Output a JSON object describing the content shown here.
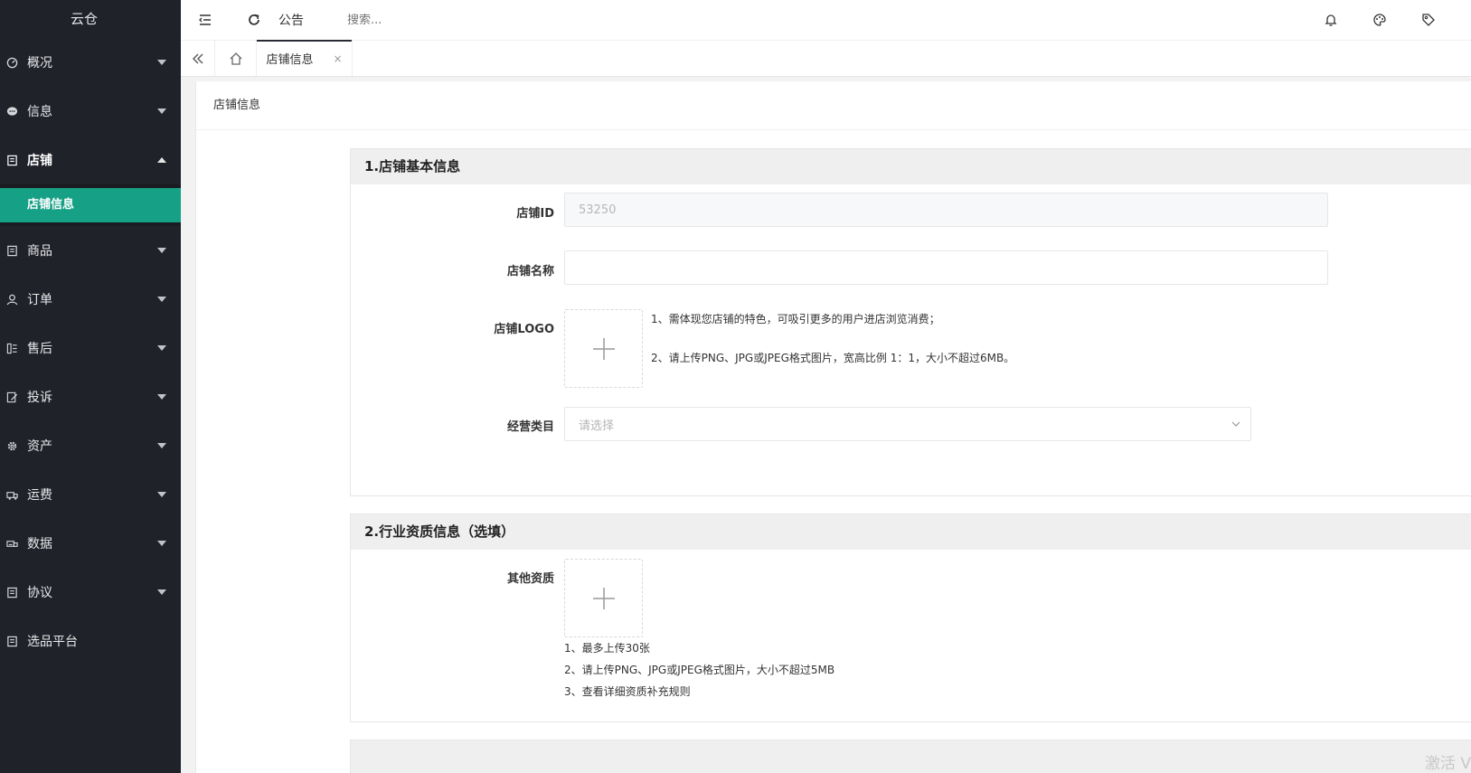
{
  "app": {
    "title": "云仓"
  },
  "sidebar": {
    "items": [
      {
        "label": "概况",
        "icon": "dashboard-icon"
      },
      {
        "label": "信息",
        "icon": "chat-bubble-icon"
      },
      {
        "label": "店铺",
        "icon": "document-icon",
        "open": true,
        "children": [
          {
            "label": "店铺信息",
            "active": true
          }
        ]
      },
      {
        "label": "商品",
        "icon": "document-icon"
      },
      {
        "label": "订单",
        "icon": "user-icon"
      },
      {
        "label": "售后",
        "icon": "list-icon"
      },
      {
        "label": "投诉",
        "icon": "edit-document-icon"
      },
      {
        "label": "资产",
        "icon": "gear-icon"
      },
      {
        "label": "运费",
        "icon": "truck-icon"
      },
      {
        "label": "数据",
        "icon": "chart-icon"
      },
      {
        "label": "协议",
        "icon": "document-icon"
      },
      {
        "label": "选品平台",
        "icon": "document-icon"
      }
    ]
  },
  "header": {
    "notice": "公告",
    "search_placeholder": "搜索..."
  },
  "tabs": {
    "active_tab": "店铺信息",
    "close_glyph": "×"
  },
  "page": {
    "card_title": "店铺信息",
    "section1": {
      "title": "1.店铺基本信息",
      "shop_id_label": "店铺ID",
      "shop_id_value": "53250",
      "shop_name_label": "店铺名称",
      "shop_name_value": "",
      "logo_label": "店铺LOGO",
      "logo_hint_1": "1、需体现您店铺的特色，可吸引更多的用户进店浏览消费；",
      "logo_hint_2": "2、请上传PNG、JPG或JPEG格式图片，宽高比例 1：1，大小不超过6MB。",
      "category_label": "经营类目",
      "category_placeholder": "请选择"
    },
    "section2": {
      "title": "2.行业资质信息（选填）",
      "other_label": "其他资质",
      "hint_1": "1、最多上传30张",
      "hint_2": "2、请上传PNG、JPG或JPEG格式图片，大小不超过5MB",
      "hint_3": "3、查看详细资质补充规则"
    }
  },
  "watermark": "激活 V",
  "colors": {
    "sidebar_bg": "#20222a",
    "accent": "#16a085"
  }
}
